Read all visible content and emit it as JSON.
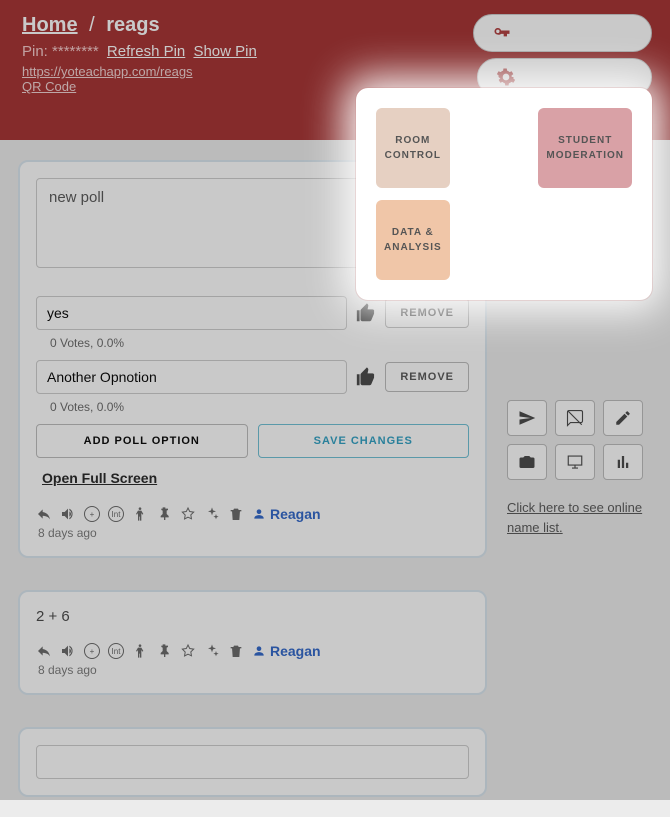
{
  "header": {
    "home_label": "Home",
    "room_name": "reags",
    "pin_label": "Pin:",
    "pin_value": "********",
    "refresh_pin": "Refresh Pin",
    "show_pin": "Show Pin",
    "room_url": "https://yoteachapp.com/reags",
    "qr_label": "QR Code",
    "admin_options": "ADMIN OPTIONS",
    "more_options": "MORE OPTIONS"
  },
  "popover": {
    "room_control": "ROOM CONTROL",
    "student_moderation": "STUDENT MODERATION",
    "data_analysis": "DATA & ANALYSIS"
  },
  "poll": {
    "question": "new poll",
    "options": [
      {
        "text": "yes",
        "votes": "0 Votes, 0.0%"
      },
      {
        "text": "Another Opnotion",
        "votes": "0 Votes, 0.0%"
      }
    ],
    "remove_label": "REMOVE",
    "add_option_label": "ADD POLL OPTION",
    "save_label": "SAVE CHANGES",
    "fullscreen_label": "Open Full Screen",
    "author": "Reagan",
    "ago": "8 days ago"
  },
  "post2": {
    "text": "2 + 6",
    "author": "Reagan",
    "ago": "8 days ago"
  },
  "sidebar": {
    "name_list_link": "Click here to see online name list."
  },
  "icons": {
    "int": "Int"
  }
}
